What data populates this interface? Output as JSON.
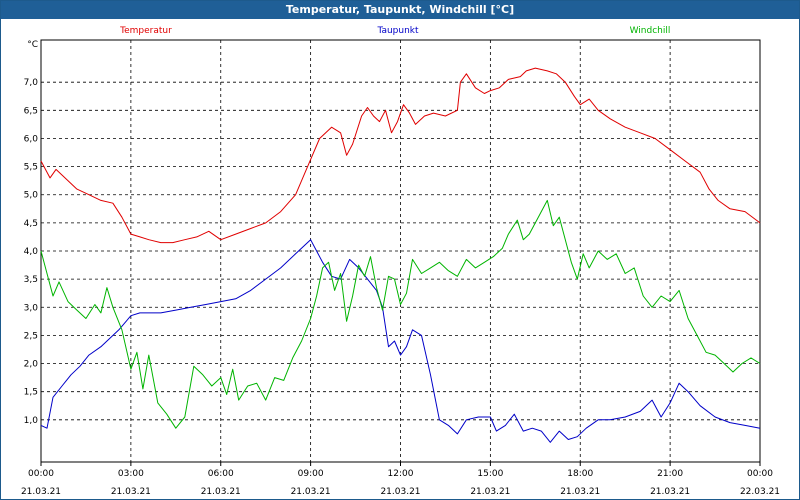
{
  "window": {
    "title": "Temperatur, Taupunkt, Windchill [°C]"
  },
  "chart_data": {
    "type": "line",
    "title": "Temperatur, Taupunkt, Windchill [°C]",
    "ylabel": "°C",
    "ylim": [
      0.25,
      7.75
    ],
    "yticks": [
      "1,0",
      "1,5",
      "2,0",
      "2,5",
      "3,0",
      "3,5",
      "4,0",
      "4,5",
      "5,0",
      "5,5",
      "6,0",
      "6,5",
      "7,0"
    ],
    "ytick_values": [
      1.0,
      1.5,
      2.0,
      2.5,
      3.0,
      3.5,
      4.0,
      4.5,
      5.0,
      5.5,
      6.0,
      6.5,
      7.0
    ],
    "xlim_hours": [
      0,
      24
    ],
    "xticks": [
      {
        "time": "00:00",
        "date": "21.03.21"
      },
      {
        "time": "03:00",
        "date": "21.03.21"
      },
      {
        "time": "06:00",
        "date": "21.03.21"
      },
      {
        "time": "09:00",
        "date": "21.03.21"
      },
      {
        "time": "12:00",
        "date": "21.03.21"
      },
      {
        "time": "15:00",
        "date": "21.03.21"
      },
      {
        "time": "18:00",
        "date": "21.03.21"
      },
      {
        "time": "21:00",
        "date": "21.03.21"
      },
      {
        "time": "00:00",
        "date": "22.03.21"
      }
    ],
    "grid": true,
    "legend_position": "top",
    "series": [
      {
        "name": "Temperatur",
        "color": "#e00000",
        "points": [
          [
            0,
            5.6
          ],
          [
            0.3,
            5.3
          ],
          [
            0.5,
            5.45
          ],
          [
            0.8,
            5.3
          ],
          [
            1.2,
            5.1
          ],
          [
            1.6,
            5.0
          ],
          [
            2.0,
            4.9
          ],
          [
            2.4,
            4.85
          ],
          [
            2.7,
            4.6
          ],
          [
            3.0,
            4.3
          ],
          [
            3.3,
            4.25
          ],
          [
            3.6,
            4.2
          ],
          [
            4.0,
            4.15
          ],
          [
            4.4,
            4.15
          ],
          [
            4.8,
            4.2
          ],
          [
            5.2,
            4.25
          ],
          [
            5.6,
            4.35
          ],
          [
            6.0,
            4.2
          ],
          [
            6.5,
            4.3
          ],
          [
            7.0,
            4.4
          ],
          [
            7.5,
            4.5
          ],
          [
            8.0,
            4.7
          ],
          [
            8.5,
            5.0
          ],
          [
            8.9,
            5.5
          ],
          [
            9.3,
            6.0
          ],
          [
            9.7,
            6.2
          ],
          [
            10.0,
            6.1
          ],
          [
            10.2,
            5.7
          ],
          [
            10.4,
            5.9
          ],
          [
            10.7,
            6.4
          ],
          [
            10.9,
            6.55
          ],
          [
            11.1,
            6.4
          ],
          [
            11.3,
            6.3
          ],
          [
            11.5,
            6.5
          ],
          [
            11.7,
            6.1
          ],
          [
            11.9,
            6.3
          ],
          [
            12.1,
            6.6
          ],
          [
            12.3,
            6.45
          ],
          [
            12.5,
            6.25
          ],
          [
            12.8,
            6.4
          ],
          [
            13.1,
            6.45
          ],
          [
            13.5,
            6.4
          ],
          [
            13.9,
            6.5
          ],
          [
            14.0,
            7.0
          ],
          [
            14.2,
            7.15
          ],
          [
            14.5,
            6.9
          ],
          [
            14.8,
            6.8
          ],
          [
            15.0,
            6.85
          ],
          [
            15.3,
            6.9
          ],
          [
            15.6,
            7.05
          ],
          [
            16.0,
            7.1
          ],
          [
            16.2,
            7.2
          ],
          [
            16.5,
            7.25
          ],
          [
            16.9,
            7.2
          ],
          [
            17.2,
            7.15
          ],
          [
            17.5,
            7.0
          ],
          [
            17.8,
            6.75
          ],
          [
            18.0,
            6.6
          ],
          [
            18.3,
            6.7
          ],
          [
            18.6,
            6.5
          ],
          [
            19.0,
            6.35
          ],
          [
            19.5,
            6.2
          ],
          [
            20.0,
            6.1
          ],
          [
            20.5,
            6.0
          ],
          [
            21.0,
            5.8
          ],
          [
            21.5,
            5.6
          ],
          [
            22.0,
            5.4
          ],
          [
            22.3,
            5.1
          ],
          [
            22.6,
            4.9
          ],
          [
            23.0,
            4.75
          ],
          [
            23.5,
            4.7
          ],
          [
            24.0,
            4.5
          ]
        ]
      },
      {
        "name": "Taupunkt",
        "color": "#0000c8",
        "points": [
          [
            0,
            0.9
          ],
          [
            0.2,
            0.85
          ],
          [
            0.4,
            1.4
          ],
          [
            0.7,
            1.6
          ],
          [
            1.0,
            1.8
          ],
          [
            1.3,
            1.95
          ],
          [
            1.6,
            2.15
          ],
          [
            2.0,
            2.3
          ],
          [
            2.3,
            2.45
          ],
          [
            2.6,
            2.6
          ],
          [
            3.0,
            2.85
          ],
          [
            3.3,
            2.9
          ],
          [
            4.0,
            2.9
          ],
          [
            4.5,
            2.95
          ],
          [
            5.0,
            3.0
          ],
          [
            5.5,
            3.05
          ],
          [
            6.0,
            3.1
          ],
          [
            6.5,
            3.15
          ],
          [
            7.0,
            3.3
          ],
          [
            7.5,
            3.5
          ],
          [
            8.0,
            3.7
          ],
          [
            8.5,
            3.95
          ],
          [
            9.0,
            4.2
          ],
          [
            9.2,
            4.0
          ],
          [
            9.4,
            3.8
          ],
          [
            9.7,
            3.55
          ],
          [
            10.0,
            3.5
          ],
          [
            10.3,
            3.85
          ],
          [
            10.6,
            3.7
          ],
          [
            10.9,
            3.5
          ],
          [
            11.2,
            3.3
          ],
          [
            11.4,
            3.0
          ],
          [
            11.6,
            2.3
          ],
          [
            11.8,
            2.4
          ],
          [
            12.0,
            2.15
          ],
          [
            12.2,
            2.3
          ],
          [
            12.4,
            2.6
          ],
          [
            12.7,
            2.5
          ],
          [
            13.0,
            1.8
          ],
          [
            13.3,
            1.0
          ],
          [
            13.6,
            0.9
          ],
          [
            13.9,
            0.75
          ],
          [
            14.2,
            1.0
          ],
          [
            14.6,
            1.05
          ],
          [
            15.0,
            1.05
          ],
          [
            15.2,
            0.8
          ],
          [
            15.5,
            0.9
          ],
          [
            15.8,
            1.1
          ],
          [
            16.1,
            0.8
          ],
          [
            16.4,
            0.85
          ],
          [
            16.7,
            0.8
          ],
          [
            17.0,
            0.6
          ],
          [
            17.3,
            0.8
          ],
          [
            17.6,
            0.65
          ],
          [
            17.9,
            0.7
          ],
          [
            18.2,
            0.85
          ],
          [
            18.6,
            1.0
          ],
          [
            19.0,
            1.0
          ],
          [
            19.5,
            1.05
          ],
          [
            20.0,
            1.15
          ],
          [
            20.4,
            1.35
          ],
          [
            20.7,
            1.05
          ],
          [
            21.0,
            1.3
          ],
          [
            21.3,
            1.65
          ],
          [
            21.6,
            1.5
          ],
          [
            22.0,
            1.25
          ],
          [
            22.5,
            1.05
          ],
          [
            23.0,
            0.95
          ],
          [
            23.5,
            0.9
          ],
          [
            24.0,
            0.85
          ]
        ]
      },
      {
        "name": "Windchill",
        "color": "#00b400",
        "points": [
          [
            0,
            4.0
          ],
          [
            0.2,
            3.6
          ],
          [
            0.4,
            3.2
          ],
          [
            0.6,
            3.45
          ],
          [
            0.9,
            3.1
          ],
          [
            1.2,
            2.95
          ],
          [
            1.5,
            2.8
          ],
          [
            1.8,
            3.05
          ],
          [
            2.0,
            2.9
          ],
          [
            2.2,
            3.35
          ],
          [
            2.4,
            3.0
          ],
          [
            2.7,
            2.6
          ],
          [
            3.0,
            1.9
          ],
          [
            3.2,
            2.2
          ],
          [
            3.4,
            1.55
          ],
          [
            3.6,
            2.15
          ],
          [
            3.9,
            1.3
          ],
          [
            4.2,
            1.1
          ],
          [
            4.5,
            0.85
          ],
          [
            4.8,
            1.05
          ],
          [
            5.1,
            1.95
          ],
          [
            5.4,
            1.8
          ],
          [
            5.7,
            1.6
          ],
          [
            6.0,
            1.75
          ],
          [
            6.2,
            1.45
          ],
          [
            6.4,
            1.9
          ],
          [
            6.6,
            1.35
          ],
          [
            6.9,
            1.6
          ],
          [
            7.2,
            1.65
          ],
          [
            7.5,
            1.35
          ],
          [
            7.8,
            1.75
          ],
          [
            8.1,
            1.7
          ],
          [
            8.4,
            2.1
          ],
          [
            8.7,
            2.4
          ],
          [
            9.0,
            2.8
          ],
          [
            9.2,
            3.2
          ],
          [
            9.4,
            3.7
          ],
          [
            9.6,
            3.8
          ],
          [
            9.8,
            3.3
          ],
          [
            10.0,
            3.6
          ],
          [
            10.2,
            2.75
          ],
          [
            10.4,
            3.2
          ],
          [
            10.6,
            3.75
          ],
          [
            10.8,
            3.55
          ],
          [
            11.0,
            3.9
          ],
          [
            11.2,
            3.35
          ],
          [
            11.4,
            2.95
          ],
          [
            11.6,
            3.55
          ],
          [
            11.8,
            3.5
          ],
          [
            12.0,
            3.05
          ],
          [
            12.2,
            3.25
          ],
          [
            12.4,
            3.85
          ],
          [
            12.7,
            3.6
          ],
          [
            13.0,
            3.7
          ],
          [
            13.3,
            3.8
          ],
          [
            13.6,
            3.65
          ],
          [
            13.9,
            3.55
          ],
          [
            14.2,
            3.85
          ],
          [
            14.5,
            3.7
          ],
          [
            14.8,
            3.8
          ],
          [
            15.1,
            3.9
          ],
          [
            15.4,
            4.05
          ],
          [
            15.6,
            4.3
          ],
          [
            15.9,
            4.55
          ],
          [
            16.1,
            4.2
          ],
          [
            16.3,
            4.3
          ],
          [
            16.5,
            4.5
          ],
          [
            16.7,
            4.7
          ],
          [
            16.9,
            4.9
          ],
          [
            17.1,
            4.45
          ],
          [
            17.3,
            4.6
          ],
          [
            17.5,
            4.2
          ],
          [
            17.7,
            3.8
          ],
          [
            17.9,
            3.5
          ],
          [
            18.1,
            3.95
          ],
          [
            18.3,
            3.7
          ],
          [
            18.6,
            4.0
          ],
          [
            18.9,
            3.85
          ],
          [
            19.2,
            3.95
          ],
          [
            19.5,
            3.6
          ],
          [
            19.8,
            3.7
          ],
          [
            20.1,
            3.2
          ],
          [
            20.4,
            3.0
          ],
          [
            20.7,
            3.2
          ],
          [
            21.0,
            3.1
          ],
          [
            21.3,
            3.3
          ],
          [
            21.6,
            2.8
          ],
          [
            21.9,
            2.5
          ],
          [
            22.2,
            2.2
          ],
          [
            22.5,
            2.15
          ],
          [
            22.8,
            2.0
          ],
          [
            23.1,
            1.85
          ],
          [
            23.4,
            2.0
          ],
          [
            23.7,
            2.1
          ],
          [
            24.0,
            2.0
          ]
        ]
      }
    ]
  }
}
